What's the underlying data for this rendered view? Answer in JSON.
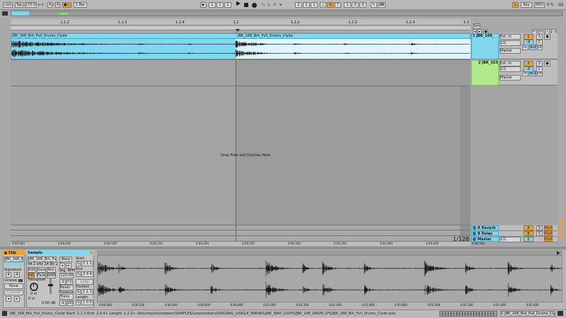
{
  "transport": {
    "link": "Link",
    "tap": "Tap",
    "tempo": "170.00",
    "time_sig_num": "4",
    "time_sig_den": "4",
    "quantize": "1 Bar",
    "position": [
      "1",
      "1",
      "1"
    ],
    "loop_start": [
      "1",
      "1",
      "1"
    ],
    "loop_length": [
      "1",
      "0",
      "0"
    ],
    "key": "Key",
    "midi": "MIDI",
    "cpu": "0 %"
  },
  "ruler": {
    "markers": [
      "1.1.2",
      "1.1.3",
      "1.1.4",
      "1.2",
      "1.2.2",
      "1.2.3",
      "1.2.4",
      "1.3"
    ],
    "set_label": "Set"
  },
  "track1": {
    "clip_name": "JBK_168_Brk_Full_Drums_Clyde",
    "header": "1 JBK_168_",
    "input": "Ext. In",
    "input_ch": "1/2",
    "monitor": [
      "In",
      "Auto",
      "Off"
    ],
    "output": "Master",
    "number": "1",
    "s": "S",
    "clip_color": "#7fd8ee"
  },
  "track2": {
    "header": "2 JBK_163_",
    "input": "Ext. In",
    "input_ch": "1/2",
    "monitor": [
      "In",
      "Auto",
      "Off"
    ],
    "output": "Master",
    "number": "2",
    "s": "S",
    "clip_color": "#b0ea8a"
  },
  "arrangement": {
    "drop_hint": "Drop Files and Devices Here",
    "timeline": [
      "0:00.000",
      "0:00.050",
      "0:00.100",
      "0:00.150",
      "0:00.200",
      "0:00.250",
      "0:00.300",
      "0:00.350",
      "0:00.400",
      "0:00.450",
      "0:00.500"
    ],
    "zoom": "1/128"
  },
  "returns": [
    {
      "name": "A Reverb",
      "letter": "A",
      "color": "#7fd8ee"
    },
    {
      "name": "B Delay",
      "letter": "B",
      "color": "#7fd8ee"
    },
    {
      "name": "Master",
      "letter": "",
      "color": "#7fd8ee"
    }
  ],
  "master_output": "1/2",
  "clip_view": {
    "clip_title": "Clip",
    "sample_title": "Sample",
    "clip_name": "JBK_168_Br",
    "sample_name": "JBK_168_Brk_Full",
    "sample_info": "44.1 kHz 24 Bit 2 Ch",
    "edit": "Edit",
    "save": "Save",
    "rev": "Rev.",
    "hiq": "HiQ",
    "fade": "Fade",
    "ram": "RAM",
    "signature_label": "Signature",
    "sig_num": "4",
    "sig_den": "4",
    "groove_label": "Groove",
    "groove_value": "None",
    "commit": "Commit",
    "transpose_label": "Transpose",
    "transpose_value": "0 st",
    "detune": "0 ct",
    "gain": "0.00 dB",
    "warp": "Warp",
    "seg_bpm_label": "Seg. BPM",
    "seg_bpm": "120.00",
    "beats": "Beats",
    "preserve": "Preserve",
    "trans": "Trans",
    "start_label": "Start",
    "start_value": "1 1 1",
    "end_label": "End",
    "end_value": "2 4 4",
    "loop": "Loop",
    "position_label": "Position",
    "position_value": "1 1 1",
    "length_label": "Length",
    "length_value": "1 0 0",
    "ruler": [
      "0:00.000",
      "0:00.200",
      "0:00.400",
      "0:00.600",
      "0:00.800",
      "0:01.000",
      "0:01.200",
      "0:01.400",
      "0:01.600",
      "0:01.800",
      "0:02.000",
      "0:02.200",
      "0:02.400",
      "0:02.600"
    ]
  },
  "status": {
    "text": "JBK_168_Brk_Full_Drums_Clyde  Start: 1.1.1  End: 2.4.4+  Length: 1.2.3+  /Volumes/Soundware/SAMPLES/Loopmasters/ORIGINAL_JUNGLE_BREAKS/JBK_WAV_LOOPS/JBK_168_DRUM_LPS/JBK_168_Brk_Full_Drums_Clyde.wav",
    "right_label": "1-JBK_168_Brk_Full_Drums_Clyde"
  }
}
